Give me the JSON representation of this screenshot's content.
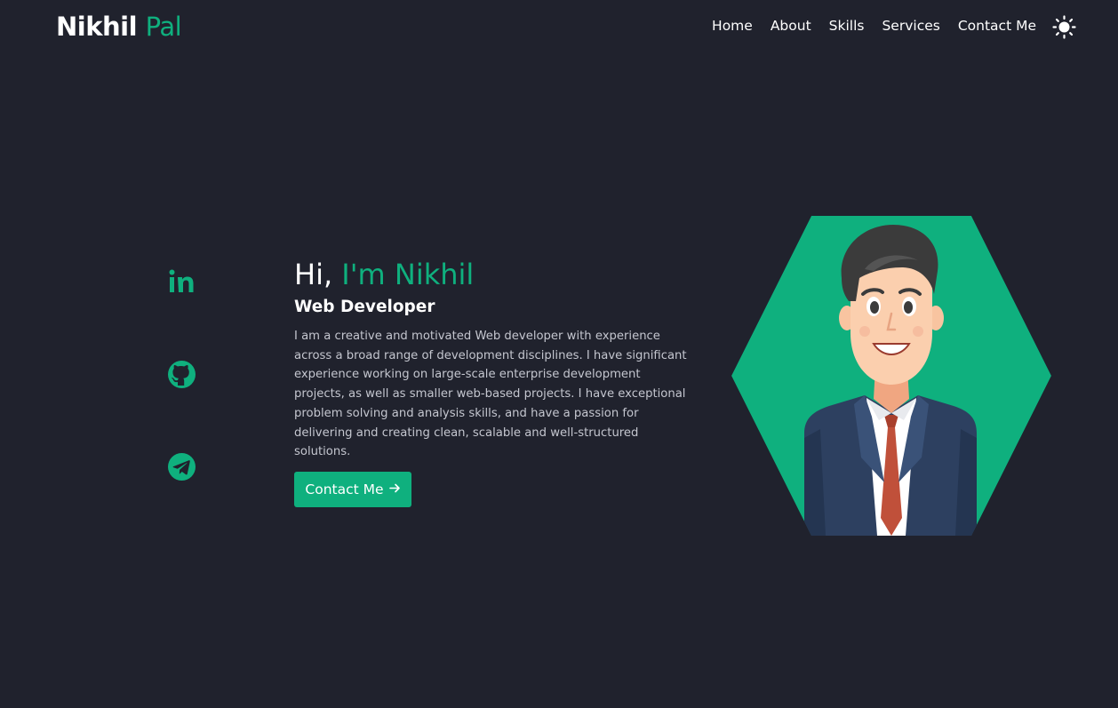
{
  "header": {
    "logo_first": "Nikhil",
    "logo_last": "Pal",
    "nav": [
      "Home",
      "About",
      "Skills",
      "Services",
      "Contact Me"
    ],
    "theme_icon": "sun-icon"
  },
  "socials": [
    {
      "name": "linkedin-icon"
    },
    {
      "name": "github-icon"
    },
    {
      "name": "telegram-icon"
    }
  ],
  "hero": {
    "greeting_prefix": "Hi,",
    "greeting_name": "I'm Nikhil",
    "role": "Web Developer",
    "bio": "I am a creative and motivated Web developer with experience across a broad range of development disciplines. I have significant experience working on large-scale enterprise development projects, as well as smaller web-based projects. I have exceptional problem solving and analysis skills, and have a passion for delivering and creating clean, scalable and well-structured solutions.",
    "cta_label": "Contact Me",
    "cta_icon": "arrow-right-icon"
  },
  "colors": {
    "background": "#20222d",
    "accent": "#0fb07e",
    "text": "#ffffff",
    "muted_text": "#c4c6cf"
  }
}
